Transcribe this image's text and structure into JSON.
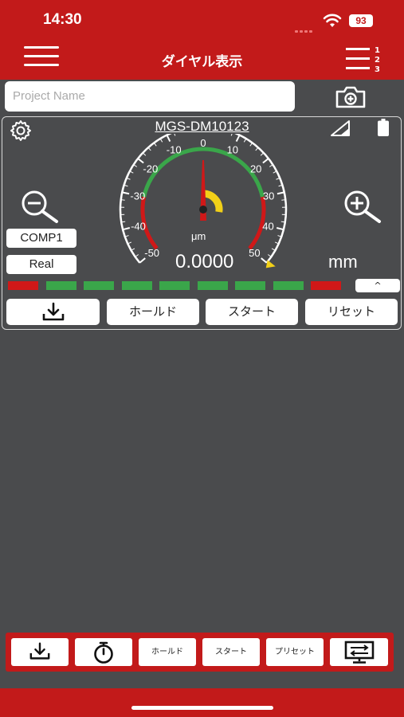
{
  "status_bar": {
    "time": "14:30",
    "battery": "93"
  },
  "nav": {
    "title": "ダイヤル表示"
  },
  "project": {
    "placeholder": "Project Name"
  },
  "device": {
    "name": "MGS-DM10123"
  },
  "left_badges": {
    "comp": "COMP1",
    "mode": "Real"
  },
  "gauge": {
    "ticks": [
      "-50",
      "-40",
      "-30",
      "-20",
      "-10",
      "0",
      "10",
      "20",
      "30",
      "40",
      "50"
    ],
    "unit_small": "μm",
    "reading": "0.0000",
    "unit": "mm",
    "needle_value": 0,
    "range": [
      -50,
      50
    ],
    "tolerance": [
      -30,
      30
    ],
    "colors": {
      "ok": "#3aa64a",
      "ng": "#d01818",
      "accent": "#f2d018",
      "marker": "#1f3fdc"
    }
  },
  "indicator_bars": [
    "red",
    "green",
    "green",
    "green",
    "green",
    "green",
    "green",
    "green",
    "red"
  ],
  "buttons": {
    "hold": "ホールド",
    "start": "スタート",
    "reset": "リセット"
  },
  "bottom": {
    "hold": "ホールド",
    "start": "スタート",
    "preset": "プリセット"
  },
  "icons": {
    "menu": "hamburger-icon",
    "list": "numbered-list-icon",
    "camera": "camera-add-icon",
    "settings": "gear-icon",
    "signal": "signal-icon",
    "battery": "battery-icon",
    "zoom_out": "zoom-out-icon",
    "zoom_in": "zoom-in-icon",
    "download": "download-icon",
    "timer": "stopwatch-icon",
    "display": "monitor-switch-icon",
    "chevron": "chevron-up-icon"
  }
}
